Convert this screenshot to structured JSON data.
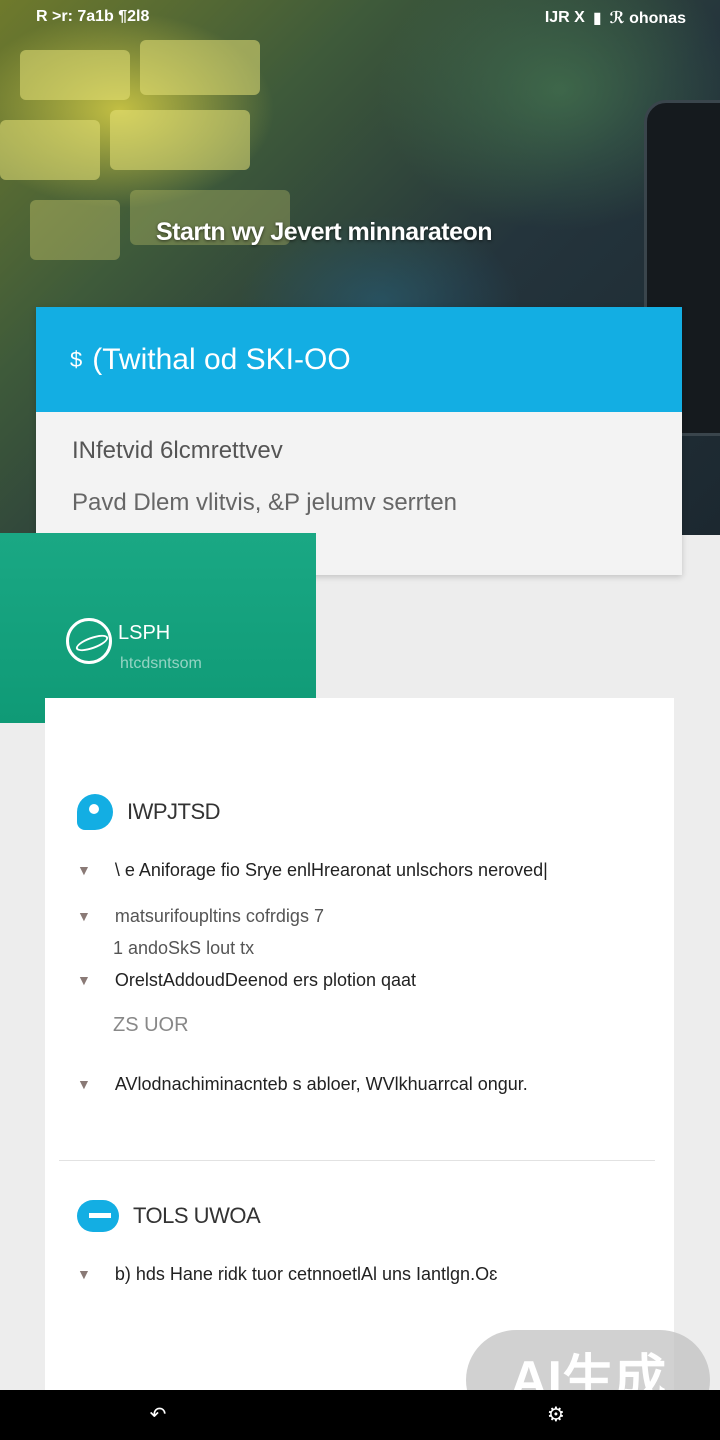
{
  "status_bar": {
    "left_text": "R >r: 7a1b ¶2l8",
    "right_text": "IJR X",
    "battery_icon": "battery-icon",
    "right_extra": "ℛ ohonas"
  },
  "hero": {
    "title": "Startn wy Jevert minnarateon"
  },
  "top_card": {
    "header": "(Twithal od SKI-OO",
    "header_icon": "$",
    "line1": "INfetvid 6lcmrettvev",
    "line2": "Pavd Dlem vlitvis, &P jelumv serrten"
  },
  "brand": {
    "name": "LSPH",
    "subtitle": "htcdsntsom"
  },
  "section1": {
    "title": "IWPJTSD",
    "bullets": [
      "\\ e Aniforage fio Srye enlHrearonat unlschors neroved|",
      "matsurifoupltins cofrdigs 7",
      "OrelstAddoudDeenod ers plotion qaat",
      "AVlodnachiminacnteb s abloer, WVlkhuarrcal ongur."
    ],
    "bullet2_extra": "1 andoSkS lout tx",
    "subhead": "ZS UOR"
  },
  "section2": {
    "title": "TOLS UWOA",
    "bullets": [
      "b) hds Hane ridk tuor cetnnoetlAl uns Iantlgn.Oɛ"
    ]
  },
  "watermark": "AI生成",
  "nav": {
    "left_icon": "nav-back-icon",
    "right_icon": "nav-settings-icon"
  },
  "colors": {
    "accent": "#13aee3",
    "green": "#15a37f"
  }
}
